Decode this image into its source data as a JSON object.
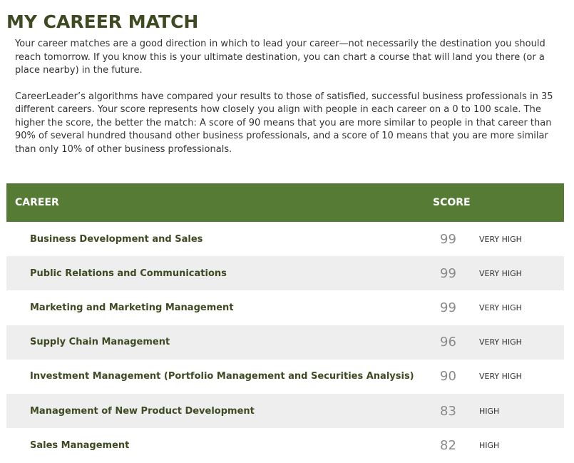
{
  "page": {
    "title": "MY CAREER MATCH"
  },
  "intro": {
    "paragraph1": "Your career matches are a good direction in which to lead your career—not necessarily the destination you should reach tomorrow. If you know this is your ultimate destination, you can chart a course that will land you there (or a place nearby) in the future.",
    "paragraph2": "CareerLeader’s algorithms have compared your results to those of satisfied, successful business professionals in 35 different careers. Your score represents how closely you align with people in each career on a 0 to 100 scale. The higher the score, the better the match: A score of 90 means that you are more similar to people in that career than 90% of several hundred thousand other business professionals, and a score of 10 means that you are more similar than only 10% of other business professionals."
  },
  "table": {
    "header_color": "#557b35",
    "columns": {
      "career": "CAREER",
      "score": "SCORE"
    },
    "rows": [
      {
        "career": "Business Development and Sales",
        "score": "99",
        "level": "VERY HIGH"
      },
      {
        "career": "Public Relations and Communications",
        "score": "99",
        "level": "VERY HIGH"
      },
      {
        "career": "Marketing and Marketing Management",
        "score": "99",
        "level": "VERY HIGH"
      },
      {
        "career": "Supply Chain Management",
        "score": "96",
        "level": "VERY HIGH"
      },
      {
        "career": "Investment Management (Portfolio Management and Securities Analysis)",
        "score": "90",
        "level": "VERY HIGH"
      },
      {
        "career": "Management of New Product Development",
        "score": "83",
        "level": "HIGH"
      },
      {
        "career": "Sales Management",
        "score": "82",
        "level": "HIGH"
      }
    ]
  }
}
